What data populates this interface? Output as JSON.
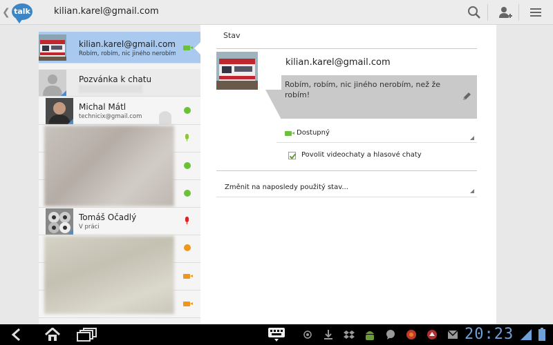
{
  "actionbar": {
    "logo_text": "talk",
    "account": "kilian.karel@gmail.com",
    "icons": [
      "search-icon",
      "add-contact-icon",
      "menu-icon"
    ]
  },
  "self": {
    "name": "kilian.karel@gmail.com",
    "status": "Robím, robím, nic jiného nerobím,"
  },
  "invite": {
    "label": "Pozvánka k chatu"
  },
  "contacts": [
    {
      "name": "Michal Mátl",
      "sub": "technicix@gmail.com",
      "indicator": "online"
    },
    {
      "name": "Tomáš Očadlý",
      "sub": "V práci",
      "indicator": "mic-busy"
    }
  ],
  "panel": {
    "title": "Stav",
    "email": "kilian.karel@gmail.com",
    "status_message": "Robím, robím, nic jiného nerobím, než že robím!",
    "availability": "Dostupný",
    "video_checkbox_label": "Povolit videochaty a hlasové chaty",
    "video_checkbox_checked": true,
    "recent_status_label": "Změnit na naposledy použitý stav..."
  },
  "colors": {
    "online": "#6cc13c",
    "busy": "#e02020",
    "away": "#f0961a",
    "selected_row": "#a9c9ee",
    "clock": "#6fa0d8"
  },
  "sysbar": {
    "clock": "20:23",
    "icons": [
      "back-icon",
      "home-icon",
      "recent-apps-icon",
      "keyboard-icon",
      "gps-icon",
      "download-icon",
      "dropbox-icon",
      "android-icon",
      "talk-notification-icon",
      "app-icon",
      "app-icon",
      "gmail-icon",
      "wifi-icon",
      "battery-icon"
    ]
  }
}
